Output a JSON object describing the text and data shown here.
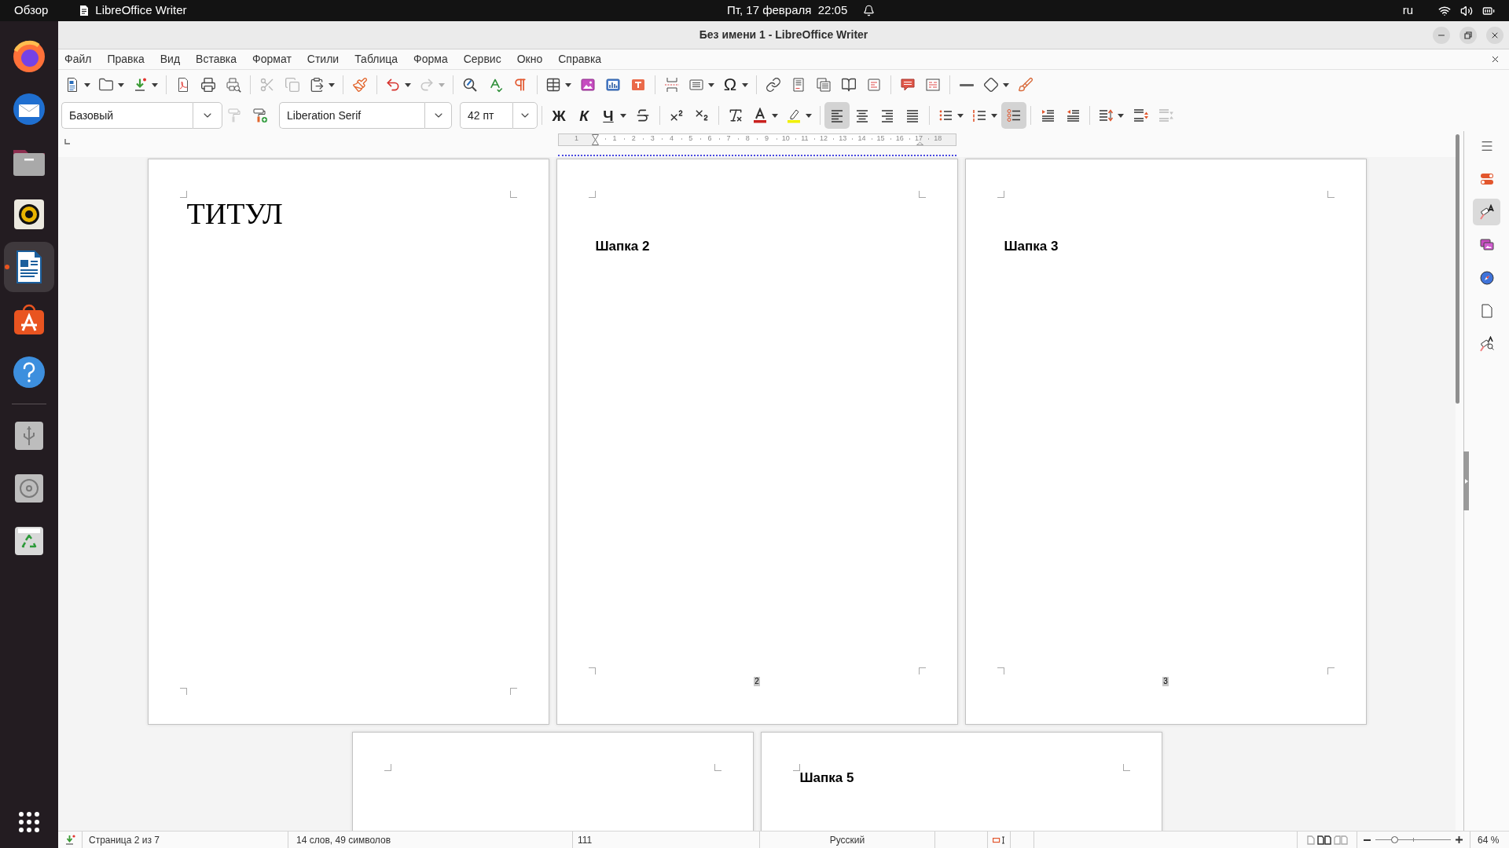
{
  "top_bar": {
    "activities": "Обзор",
    "app_name": "LibreOffice Writer",
    "clock": "Пт, 17 февраля  22:05",
    "keyboard_layout": "ru"
  },
  "dock": {
    "apps": [
      {
        "kind": "browser",
        "selected": false,
        "running": false
      },
      {
        "kind": "mail",
        "selected": false,
        "running": false
      },
      {
        "kind": "files",
        "selected": false,
        "running": false
      },
      {
        "kind": "music",
        "selected": false,
        "running": false
      },
      {
        "kind": "writer",
        "selected": true,
        "running": true
      },
      {
        "kind": "store",
        "selected": false,
        "running": false
      },
      {
        "kind": "help",
        "selected": false,
        "running": false
      }
    ],
    "devices": [
      {
        "kind": "usb"
      },
      {
        "kind": "disc"
      },
      {
        "kind": "trash"
      }
    ]
  },
  "window": {
    "title": "Без имени 1 - LibreOffice Writer"
  },
  "menu": [
    "Файл",
    "Правка",
    "Вид",
    "Вставка",
    "Формат",
    "Стили",
    "Таблица",
    "Форма",
    "Сервис",
    "Окно",
    "Справка"
  ],
  "standard_toolbar": [
    {
      "kind": "new",
      "dropdown": true,
      "disabled": false
    },
    {
      "kind": "open",
      "dropdown": true,
      "disabled": false
    },
    {
      "kind": "save",
      "dropdown": true,
      "disabled": false
    },
    {
      "kind": "separator"
    },
    {
      "kind": "export_pdf",
      "disabled": false
    },
    {
      "kind": "print",
      "disabled": false
    },
    {
      "kind": "print_preview",
      "disabled": false
    },
    {
      "kind": "separator"
    },
    {
      "kind": "cut",
      "disabled": true
    },
    {
      "kind": "copy",
      "disabled": true
    },
    {
      "kind": "paste",
      "dropdown": true,
      "disabled": false
    },
    {
      "kind": "separator"
    },
    {
      "kind": "clone_formatting",
      "disabled": false
    },
    {
      "kind": "separator"
    },
    {
      "kind": "undo",
      "dropdown": true,
      "disabled": false
    },
    {
      "kind": "redo",
      "dropdown": true,
      "disabled": true
    },
    {
      "kind": "separator"
    },
    {
      "kind": "find_replace",
      "disabled": false
    },
    {
      "kind": "spelling",
      "disabled": false
    },
    {
      "kind": "formatting_marks",
      "disabled": false
    },
    {
      "kind": "separator"
    },
    {
      "kind": "table",
      "dropdown": true,
      "disabled": false
    },
    {
      "kind": "image",
      "disabled": false
    },
    {
      "kind": "chart",
      "disabled": false
    },
    {
      "kind": "text_box",
      "disabled": false
    },
    {
      "kind": "separator"
    },
    {
      "kind": "page_break",
      "disabled": false
    },
    {
      "kind": "field",
      "dropdown": true,
      "disabled": false
    },
    {
      "kind": "special_character",
      "label": "Ω",
      "dropdown": true,
      "disabled": false
    },
    {
      "kind": "separator"
    },
    {
      "kind": "hyperlink",
      "disabled": false
    },
    {
      "kind": "footnote",
      "disabled": false
    },
    {
      "kind": "endnote",
      "disabled": false
    },
    {
      "kind": "bookmark",
      "disabled": false
    },
    {
      "kind": "cross_reference",
      "disabled": false
    },
    {
      "kind": "separator"
    },
    {
      "kind": "comment",
      "disabled": false
    },
    {
      "kind": "track_changes",
      "disabled": false
    },
    {
      "kind": "separator"
    },
    {
      "kind": "line",
      "disabled": false
    },
    {
      "kind": "shapes",
      "dropdown": true,
      "disabled": false
    },
    {
      "kind": "draw",
      "disabled": false
    }
  ],
  "formatting_toolbar": [
    {
      "kind": "paragraph_style",
      "value": "Базовый"
    },
    {
      "kind": "update_style",
      "disabled": true,
      "pressed": false
    },
    {
      "kind": "new_style",
      "disabled": false,
      "pressed": false
    },
    {
      "kind": "font_name",
      "value": "Liberation Serif"
    },
    {
      "kind": "font_size",
      "value": "42 пт"
    },
    {
      "kind": "separator"
    },
    {
      "kind": "bold",
      "label": "Ж",
      "disabled": false,
      "pressed": false
    },
    {
      "kind": "italic",
      "label": "К",
      "disabled": false,
      "pressed": false
    },
    {
      "kind": "underline",
      "label": "Ч",
      "dropdown": true,
      "disabled": false,
      "pressed": false
    },
    {
      "kind": "strikethrough",
      "disabled": false,
      "pressed": false
    },
    {
      "kind": "separator"
    },
    {
      "kind": "superscript",
      "disabled": false,
      "pressed": false
    },
    {
      "kind": "subscript",
      "disabled": false,
      "pressed": false
    },
    {
      "kind": "separator"
    },
    {
      "kind": "clear_formatting",
      "disabled": false,
      "pressed": false
    },
    {
      "kind": "font_color",
      "dropdown": true,
      "disabled": false,
      "pressed": false
    },
    {
      "kind": "highlight",
      "dropdown": true,
      "disabled": false,
      "pressed": false
    },
    {
      "kind": "separator"
    },
    {
      "kind": "align_left",
      "disabled": false,
      "pressed": true
    },
    {
      "kind": "align_center",
      "disabled": false,
      "pressed": false
    },
    {
      "kind": "align_right",
      "disabled": false,
      "pressed": false
    },
    {
      "kind": "align_justify",
      "disabled": false,
      "pressed": false
    },
    {
      "kind": "separator"
    },
    {
      "kind": "bullets",
      "dropdown": true,
      "disabled": false,
      "pressed": false
    },
    {
      "kind": "numbering",
      "dropdown": true,
      "disabled": false,
      "pressed": false
    },
    {
      "kind": "outline",
      "disabled": false,
      "pressed": true
    },
    {
      "kind": "separator"
    },
    {
      "kind": "indent_increase",
      "disabled": false,
      "pressed": false
    },
    {
      "kind": "indent_decrease",
      "disabled": false,
      "pressed": false
    },
    {
      "kind": "separator"
    },
    {
      "kind": "line_spacing",
      "dropdown": true,
      "disabled": false,
      "pressed": false
    },
    {
      "kind": "paragraph_spacing_increase",
      "disabled": false,
      "pressed": false
    },
    {
      "kind": "paragraph_spacing_decrease",
      "disabled": true,
      "pressed": false
    }
  ],
  "ruler": {
    "labels": [
      "1",
      "1",
      "2",
      "3",
      "4",
      "5",
      "6",
      "7",
      "8",
      "9",
      "10",
      "11",
      "12",
      "13",
      "14",
      "15",
      "16",
      "17",
      "18"
    ]
  },
  "pages": [
    {
      "kind": "title",
      "title": "ТИТУЛ"
    },
    {
      "kind": "header_footer",
      "heading": "Шапка 2",
      "page_number": "2"
    },
    {
      "kind": "header_footer",
      "heading": "Шапка 3",
      "page_number": "3"
    },
    {
      "kind": "plain"
    },
    {
      "kind": "plain",
      "heading": "Шапка 5"
    }
  ],
  "sidebar": {
    "tabs": [
      {
        "kind": "properties",
        "selected": false
      },
      {
        "kind": "styles",
        "selected": true
      },
      {
        "kind": "gallery",
        "selected": false
      },
      {
        "kind": "navigator",
        "selected": false
      },
      {
        "kind": "page",
        "selected": false
      },
      {
        "kind": "style_inspector",
        "selected": false
      }
    ]
  },
  "status_bar": {
    "page": "Страница 2 из 7",
    "words": "14 слов, 49 символов",
    "page_style": "111",
    "language": "Русский",
    "view_layouts": [
      {
        "kind": "single",
        "selected": false
      },
      {
        "kind": "multi",
        "selected": true
      },
      {
        "kind": "book",
        "selected": false
      }
    ],
    "zoom": {
      "level": 0.26,
      "reading": "64 %"
    }
  }
}
